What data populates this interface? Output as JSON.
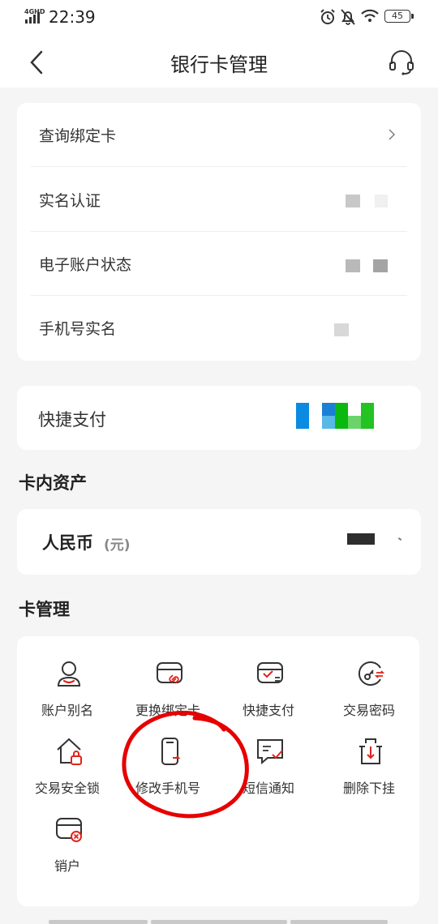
{
  "status_bar": {
    "network": "4GHD",
    "time": "22:39",
    "battery": "45"
  },
  "nav": {
    "title": "银行卡管理"
  },
  "card_info": {
    "rows": [
      {
        "label": "查询绑定卡"
      },
      {
        "label": "实名认证"
      },
      {
        "label": "电子账户状态"
      },
      {
        "label": "手机号实名"
      }
    ]
  },
  "quick_pay": {
    "label": "快捷支付"
  },
  "assets": {
    "section_title": "卡内资产",
    "currency_label": "人民币",
    "currency_unit": "(元)"
  },
  "management": {
    "section_title": "卡管理",
    "items": [
      {
        "label": "账户别名",
        "icon": "person-icon"
      },
      {
        "label": "更换绑定卡",
        "icon": "card-link-icon"
      },
      {
        "label": "快捷支付",
        "icon": "card-check-icon"
      },
      {
        "label": "交易密码",
        "icon": "key-dial-icon"
      },
      {
        "label": "交易安全锁",
        "icon": "house-lock-icon"
      },
      {
        "label": "修改手机号",
        "icon": "phone-icon"
      },
      {
        "label": "短信通知",
        "icon": "message-check-icon"
      },
      {
        "label": "删除下挂",
        "icon": "delete-attach-icon"
      },
      {
        "label": "销户",
        "icon": "card-cancel-icon"
      }
    ]
  },
  "colors": {
    "accent_red": "#e2231a",
    "background": "#f5f5f5",
    "annotation_red": "#e60000"
  }
}
